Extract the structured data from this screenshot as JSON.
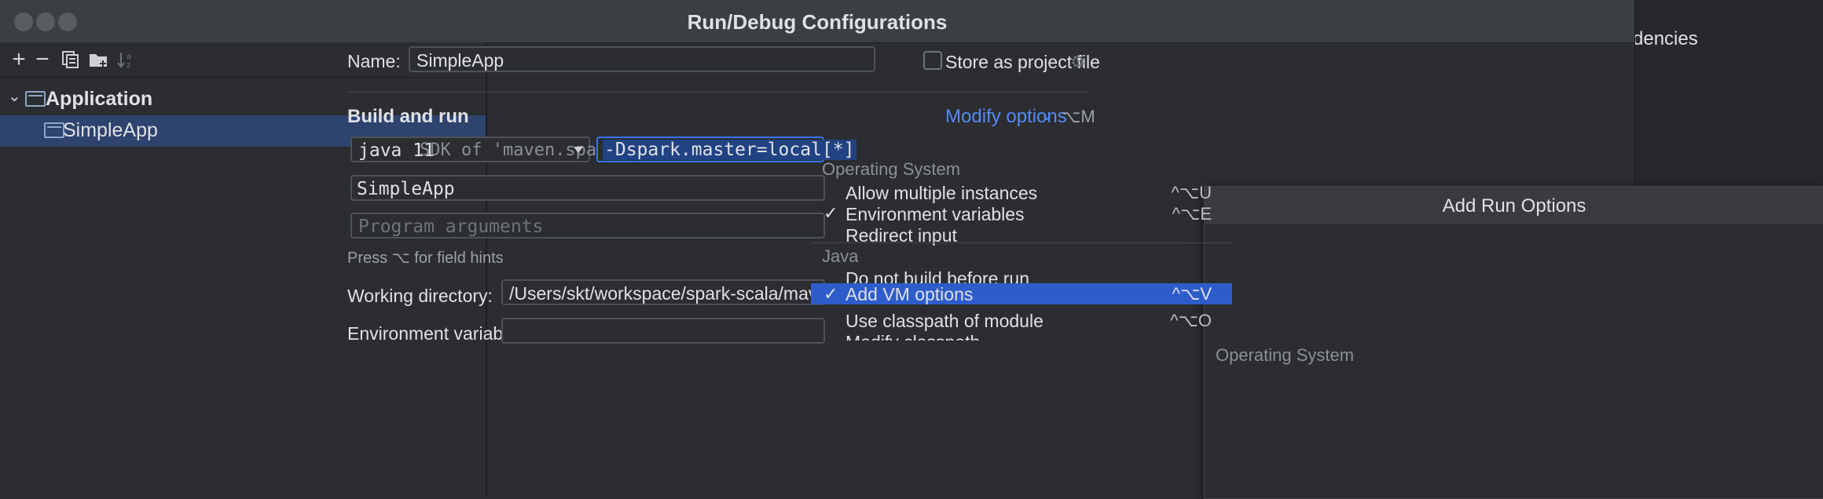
{
  "background": {
    "partial_text": "dencies"
  },
  "dialog": {
    "title": "Run/Debug Configurations"
  },
  "toolbar": {
    "icons": [
      "add-icon",
      "remove-icon",
      "copy-icon",
      "new-folder-icon",
      "sort-icon"
    ]
  },
  "tree": {
    "group": {
      "label": "Application",
      "expanded": true
    },
    "items": [
      {
        "label": "SimpleApp",
        "selected": true
      }
    ]
  },
  "form": {
    "name_label": "Name:",
    "name_value": "SimpleApp",
    "store_label": "Store as project file",
    "store_checked": false,
    "section_title": "Build and run",
    "modify_options_label": "Modify options",
    "modify_options_shortcut": "⌥M",
    "jdk_value": "java 11",
    "jdk_hint": "SDK of 'maven.spark",
    "vm_options_value": "-Dspark.master=local[*]",
    "main_class_value": "SimpleApp",
    "program_args_placeholder": "Program arguments",
    "field_hint": "Press ⌥ for field hints",
    "working_dir_label": "Working directory:",
    "working_dir_value": "/Users/skt/workspace/spark-scala/maven.spark",
    "env_vars_label": "Environment variables:"
  },
  "popup": {
    "title": "Add Run Options",
    "groups": [
      {
        "label": "Operating System",
        "items": [
          {
            "label": "Allow multiple instances",
            "shortcut": "^⌥U",
            "checked": false
          },
          {
            "label": "Environment variables",
            "shortcut": "^⌥E",
            "checked": true
          },
          {
            "label": "Redirect input",
            "shortcut": "",
            "checked": false
          }
        ]
      },
      {
        "label": "Java",
        "items": [
          {
            "label": "Do not build before run",
            "shortcut": "",
            "checked": false
          },
          {
            "label": "Add VM options",
            "shortcut": "^⌥V",
            "checked": true,
            "selected": true
          },
          {
            "label": "Use classpath of module",
            "shortcut": "^⌥O",
            "checked": false
          },
          {
            "label": "Modify classpath",
            "shortcut": "",
            "checked": false
          }
        ]
      }
    ],
    "check_mark": "✓"
  },
  "colors": {
    "accent": "#548af7",
    "selection": "#2e5ccb",
    "tree_selection": "#2e436e"
  }
}
